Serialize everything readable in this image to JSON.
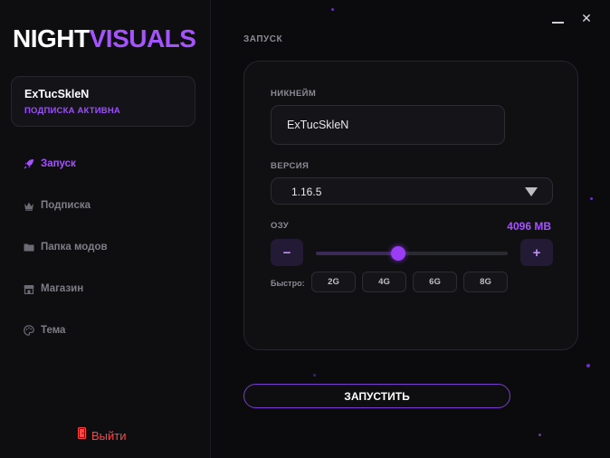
{
  "brand": {
    "part1": "NIGHT",
    "part2": "VISUALS"
  },
  "profile": {
    "name": "ExTucSkleN",
    "status": "ПОДПИСКА АКТИВНА"
  },
  "nav": {
    "items": [
      {
        "label": "Запуск",
        "icon": "rocket-icon",
        "active": true
      },
      {
        "label": "Подписка",
        "icon": "crown-icon",
        "active": false
      },
      {
        "label": "Папка модов",
        "icon": "folder-icon",
        "active": false
      },
      {
        "label": "Магазин",
        "icon": "shop-icon",
        "active": false
      },
      {
        "label": "Тема",
        "icon": "palette-icon",
        "active": false
      }
    ]
  },
  "logout": {
    "label": "Выйти",
    "icon": "exit-door-icon"
  },
  "window": {
    "minimize": "—",
    "close": "✕"
  },
  "main": {
    "section_title": "ЗАПУСК",
    "nickname": {
      "label": "НИКНЕЙМ",
      "value": "ExTucSkleN"
    },
    "version": {
      "label": "ВЕРСИЯ",
      "value": "1.16.5"
    },
    "memory": {
      "label": "ОЗУ",
      "value": "4096 MB",
      "minus": "−",
      "plus": "+",
      "slider_fraction": 0.43,
      "quick_label": "Быстро:",
      "quick_options": [
        "2G",
        "4G",
        "6G",
        "8G"
      ]
    },
    "launch_button": "ЗАПУСТИТЬ"
  },
  "colors": {
    "accent": "#a552ff",
    "danger": "#ff4545",
    "background": "#0b0b0d"
  }
}
